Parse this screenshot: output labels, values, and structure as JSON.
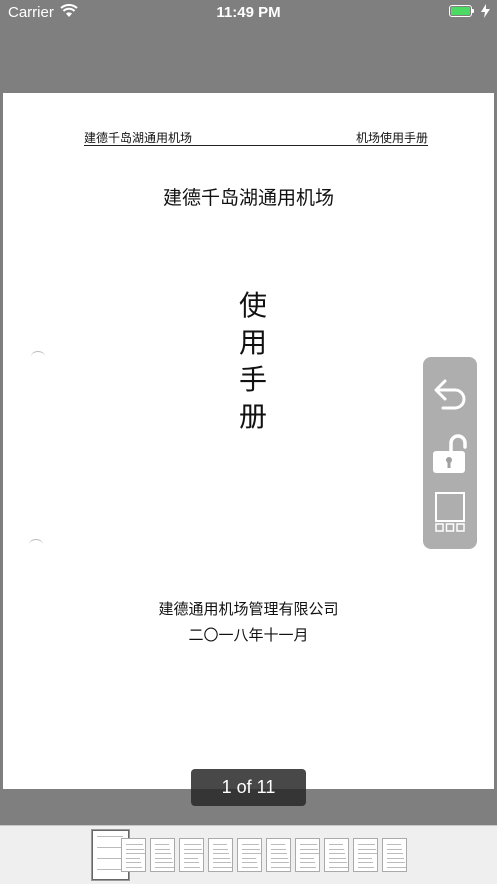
{
  "status_bar": {
    "carrier": "Carrier",
    "time": "11:49 PM",
    "battery_level": 1.0,
    "battery_color": "#4cd964",
    "icons": [
      "wifi-icon",
      "battery-icon",
      "charging-bolt-icon"
    ]
  },
  "document": {
    "header_left": "建德千岛湖通用机场",
    "header_right": "机场使用手册",
    "title": "建德千岛湖通用机场",
    "vertical_title": [
      "使",
      "用",
      "手",
      "册"
    ],
    "company": "建德通用机场管理有限公司",
    "date": "二〇一八年十一月"
  },
  "toolbar": {
    "items": [
      {
        "icon": "undo-arrow-icon"
      },
      {
        "icon": "unlock-icon"
      },
      {
        "icon": "page-grid-icon"
      }
    ]
  },
  "page_indicator": {
    "text": "1 of 11",
    "current": 1,
    "total": 11
  },
  "thumbnails": {
    "count": 11,
    "selected_index": 0
  }
}
